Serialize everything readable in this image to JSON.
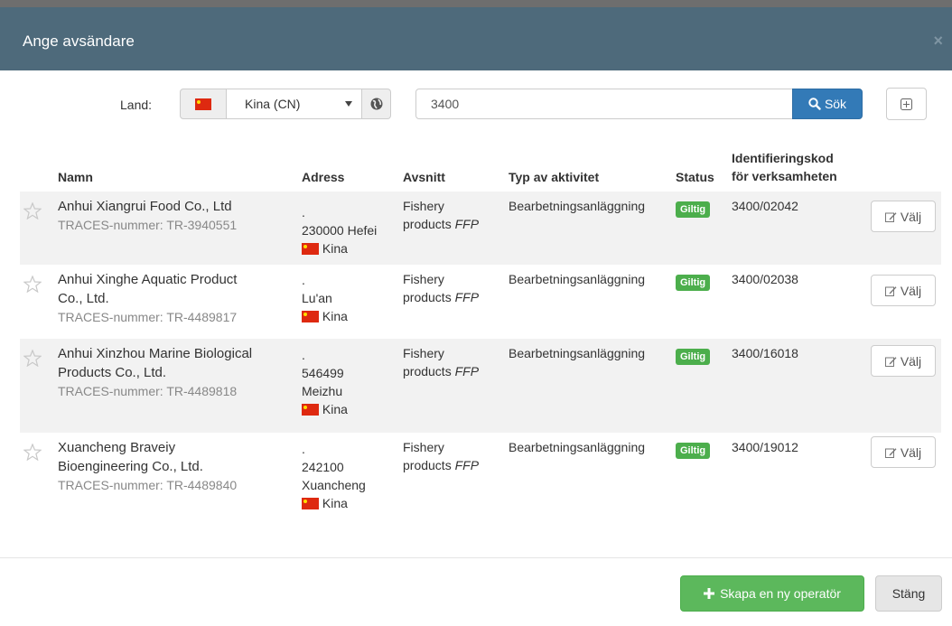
{
  "modal": {
    "title": "Ange avsändare",
    "close_icon": "×"
  },
  "search": {
    "land_label": "Land:",
    "country_value": "Kina (CN)",
    "query_value": "3400",
    "search_button_label": "Sök"
  },
  "table": {
    "headers": {
      "name": "Namn",
      "address": "Adress",
      "section": "Avsnitt",
      "activity": "Typ av aktivitet",
      "status": "Status",
      "idcode_line1": "Identifieringskod",
      "idcode_line2": "för verksamheten"
    },
    "rows": [
      {
        "name_line1": "Anhui Xiangrui Food Co., Ltd",
        "name_line2": "",
        "traces": "TRACES-nummer: TR-3940551",
        "addr_dot": ".",
        "addr_line1": "230000 Hefei",
        "addr_line2": "",
        "country": "Kina",
        "section_line1": "Fishery",
        "section_line2": "products",
        "section_tag": "FFP",
        "activity": "Bearbetningsanläggning",
        "status": "Giltig",
        "idcode": "3400/02042",
        "select_label": "Välj"
      },
      {
        "name_line1": "Anhui Xinghe Aquatic Product",
        "name_line2": "Co., Ltd.",
        "traces": "TRACES-nummer: TR-4489817",
        "addr_dot": ".",
        "addr_line1": "Lu'an",
        "addr_line2": "",
        "country": "Kina",
        "section_line1": "Fishery",
        "section_line2": "products",
        "section_tag": "FFP",
        "activity": "Bearbetningsanläggning",
        "status": "Giltig",
        "idcode": "3400/02038",
        "select_label": "Välj"
      },
      {
        "name_line1": "Anhui Xinzhou Marine Biological",
        "name_line2": "Products Co., Ltd.",
        "traces": "TRACES-nummer: TR-4489818",
        "addr_dot": ".",
        "addr_line1": "546499",
        "addr_line2": "Meizhu",
        "country": "Kina",
        "section_line1": "Fishery",
        "section_line2": "products",
        "section_tag": "FFP",
        "activity": "Bearbetningsanläggning",
        "status": "Giltig",
        "idcode": "3400/16018",
        "select_label": "Välj"
      },
      {
        "name_line1": "Xuancheng Braveiy",
        "name_line2": "Bioengineering Co., Ltd.",
        "traces": "TRACES-nummer: TR-4489840",
        "addr_dot": ".",
        "addr_line1": "242100",
        "addr_line2": "Xuancheng",
        "country": "Kina",
        "section_line1": "Fishery",
        "section_line2": "products",
        "section_tag": "FFP",
        "activity": "Bearbetningsanläggning",
        "status": "Giltig",
        "idcode": "3400/19012",
        "select_label": "Välj"
      }
    ]
  },
  "footer": {
    "create_label": "Skapa en ny operatör",
    "close_label": "Stäng"
  },
  "colors": {
    "header_bg": "#4e6a7b",
    "primary": "#337ab7",
    "success": "#5cb85c",
    "badge": "#4cae4c"
  },
  "icons": {
    "flag": "china-flag-icon",
    "caret": "caret-down-icon",
    "globe": "globe-icon",
    "search": "search-icon",
    "expand": "plus-square-icon",
    "star": "star-outline-icon",
    "edit": "edit-icon",
    "plus": "plus-icon"
  }
}
